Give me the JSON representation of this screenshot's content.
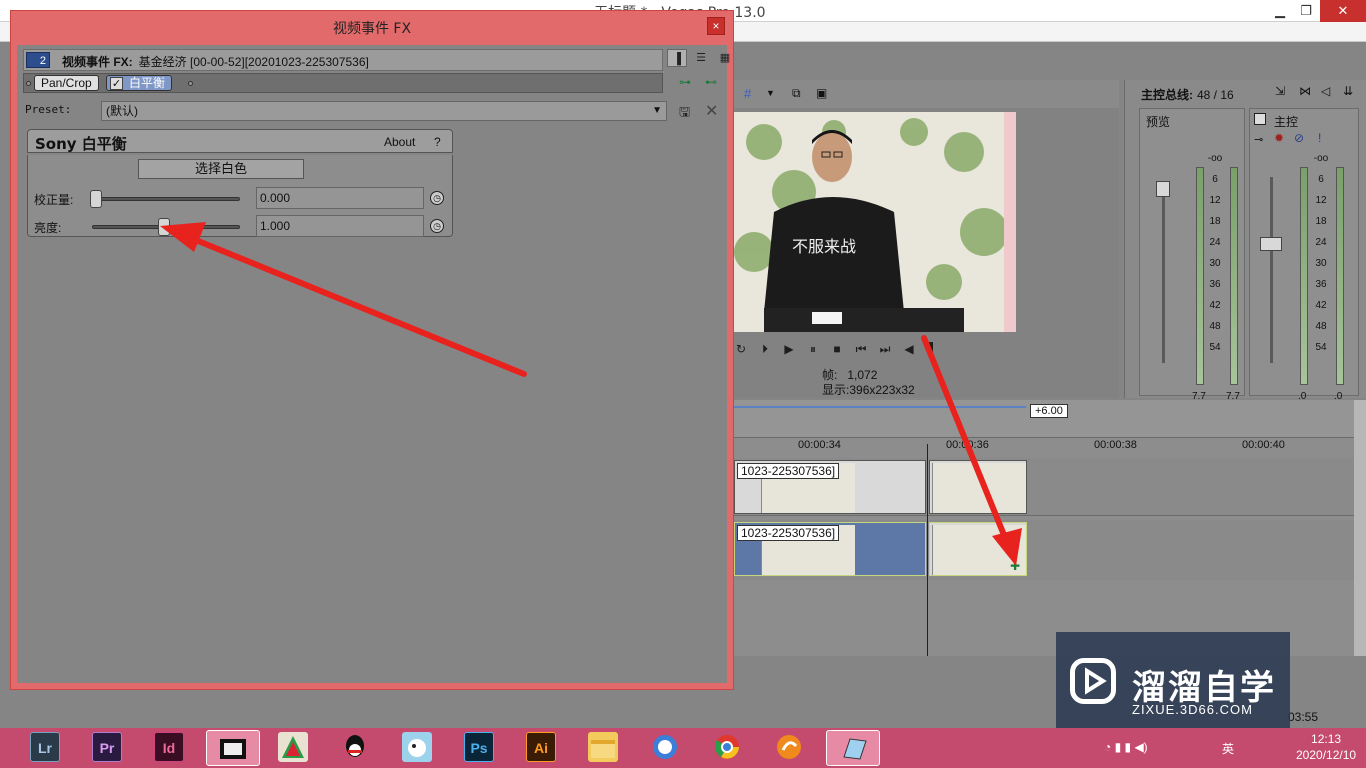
{
  "app": {
    "title": "无标题 * - Vegas Pro 13.0",
    "minimize": "▁",
    "maximize": "❐",
    "close": "✕"
  },
  "preview": {
    "frame_label": "帧:",
    "frame_value": "1,072",
    "display_label": "显示:",
    "display_value": "396x223x32"
  },
  "mixer": {
    "title": "主控总线:",
    "count": "48 / 16",
    "preview_label": "预览",
    "master_label": "主控",
    "scale": [
      "-oo",
      "6",
      "12",
      "18",
      "24",
      "30",
      "36",
      "42",
      "48",
      "54"
    ],
    "left_values": [
      "7.7",
      "7.7"
    ],
    "right_values": [
      ".0",
      ".0"
    ]
  },
  "timeline": {
    "pan_value": "+6.00",
    "ticks": [
      "00:00:34",
      "00:00:36",
      "00:00:38",
      "00:00:40"
    ],
    "clip_label": "1023-225307536]",
    "time_readout": "03:55"
  },
  "fx": {
    "window_title": "视频事件 FX",
    "close": "×",
    "chain_badge": "2",
    "chain_prefix": "视频事件 FX:",
    "chain_name": "基金经济 [00-00-52][20201023-225307536]",
    "plugins": [
      "Pan/Crop",
      "白平衡"
    ],
    "preset_label": "Preset:",
    "preset_value": "(默认)",
    "panel_title": "Sony 白平衡",
    "about": "About",
    "help": "?",
    "pick_white": "选择白色",
    "params": [
      {
        "label": "校正量:",
        "value": "0.000",
        "level": 0.0
      },
      {
        "label": "亮度:",
        "value": "1.000",
        "level": 0.5
      }
    ]
  },
  "watermark": {
    "text": "溜溜自学",
    "sub": "ZIXUE.3D66.COM"
  },
  "taskbar": {
    "apps": [
      "Lr",
      "Pr",
      "Id",
      "",
      "",
      "",
      "",
      "Ps",
      "Ai",
      "",
      "",
      "",
      "",
      ""
    ],
    "time": "12:13",
    "date": "2020/12/10",
    "ime": "英"
  },
  "colors": {
    "dialog_border": "#e36a6a",
    "arrow": "#e8231e",
    "taskbar": "#c44a6e"
  }
}
